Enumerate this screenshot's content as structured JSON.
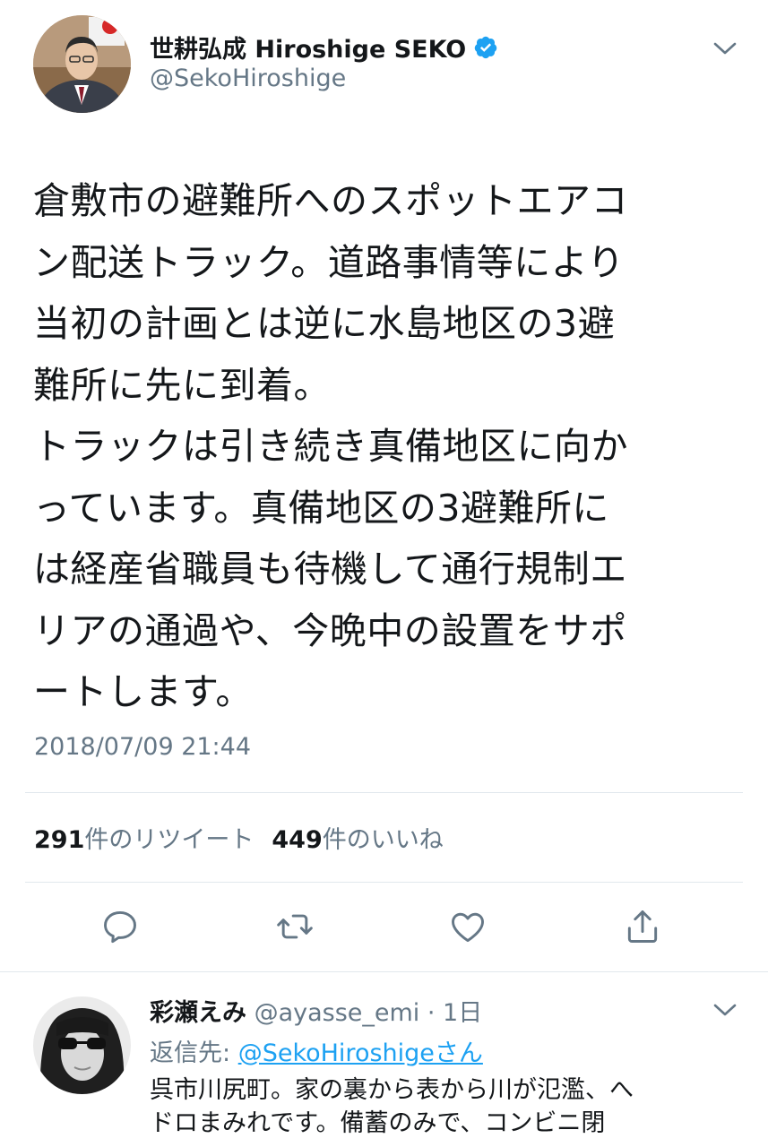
{
  "tweet": {
    "author_name": "世耕弘成 Hiroshige SEKO",
    "author_handle": "@SekoHiroshige",
    "text": "倉敷市の避難所へのスポットエアコ\nン配送トラック。道路事情等により\n当初の計画とは逆に水島地区の3避\n難所に先に到着。\nトラックは引き続き真備地区に向か\nっています。真備地区の3避難所に\nは経産省職員も待機して通行規制エ\nリアの通過や、今晩中の設置をサポ\nートします。",
    "timestamp": "2018/07/09 21:44",
    "retweet_count": "291",
    "retweet_label": "件のリツイート",
    "like_count": "449",
    "like_label": "件のいいね"
  },
  "actions": [
    {
      "icon": "reply-icon"
    },
    {
      "icon": "retweet-icon"
    },
    {
      "icon": "like-icon"
    },
    {
      "icon": "share-icon"
    }
  ],
  "reply": {
    "author_name": "彩瀬えみ",
    "meta": " @ayasse_emi · 1日",
    "reply_to_label": "返信先: ",
    "reply_to_mention": "@SekoHiroshigeさん",
    "text": "呉市川尻町。家の裏から表から川が氾濫、へ\nドロまみれです。備蓄のみで、コンビニ閉"
  },
  "colors": {
    "verified": "#1da1f2",
    "link": "#1da1f2",
    "secondary_text": "#657786",
    "divider": "#e1e8ed",
    "icon": "#657786"
  }
}
